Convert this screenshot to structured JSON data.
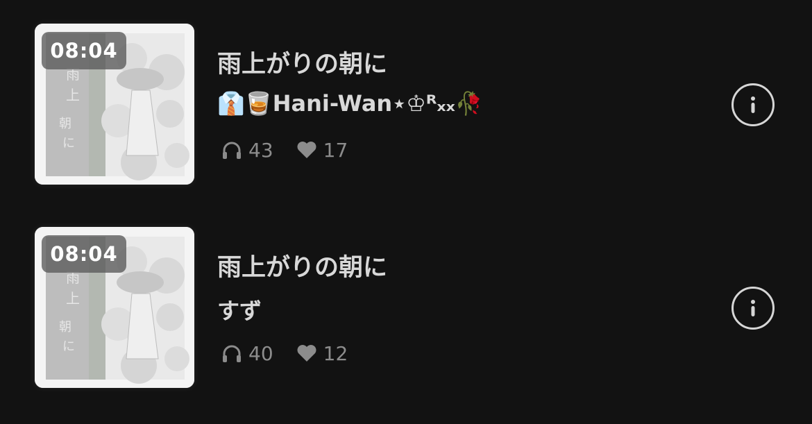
{
  "tracks": [
    {
      "duration": "08:04",
      "title": "雨上がりの朝に",
      "artist": "👔🥃Hani-Wan⋆♔ᴿₓₓ🥀",
      "plays": "43",
      "likes": "17"
    },
    {
      "duration": "08:04",
      "title": "雨上がりの朝に",
      "artist": "すず",
      "plays": "40",
      "likes": "12"
    }
  ],
  "icons": {
    "plays": "headphones-icon",
    "likes": "heart-icon",
    "info": "info-icon"
  },
  "colors": {
    "background": "#121212",
    "text": "#d8d8d8",
    "muted": "#8c8c8c"
  }
}
